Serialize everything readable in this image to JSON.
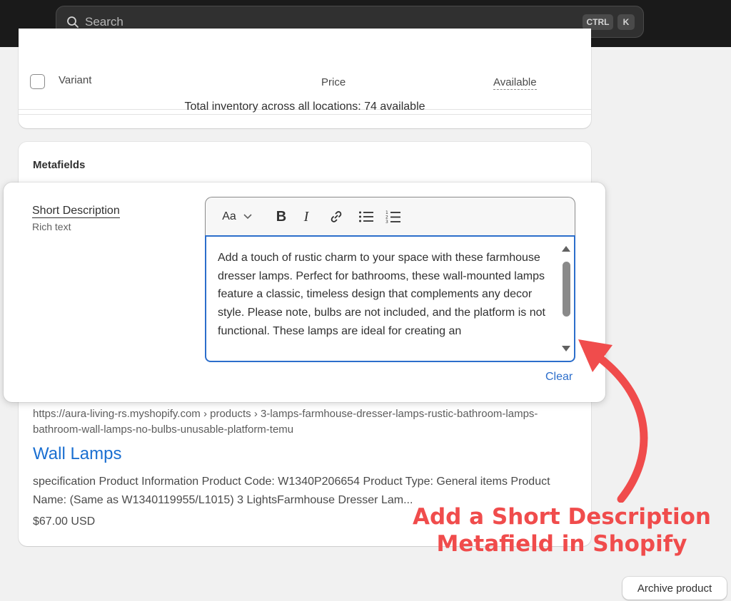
{
  "search": {
    "placeholder": "Search",
    "shortcut_ctrl": "CTRL",
    "shortcut_key": "K"
  },
  "variants": {
    "columns": {
      "variant": "Variant",
      "price": "Price",
      "available": "Available"
    },
    "total_inventory": "Total inventory across all locations: 74 available"
  },
  "metafields": {
    "title": "Metafields",
    "field": {
      "label": "Short Description",
      "type": "Rich text",
      "value": "Add a touch of rustic charm to your space with these farmhouse dresser lamps. Perfect for bathrooms, these wall-mounted lamps feature a classic, timeless design that complements any decor style. Please note, bulbs are not included, and the platform is not functional. These lamps are ideal for creating an",
      "clear_label": "Clear"
    },
    "toolbar": {
      "text_style": "Aa",
      "bold": "B",
      "italic": "I"
    }
  },
  "seo_preview": {
    "url": "https://aura-living-rs.myshopify.com › products › 3-lamps-farmhouse-dresser-lamps-rustic-bathroom-lamps-bathroom-wall-lamps-no-bulbs-unusable-platform-temu",
    "title": "Wall Lamps",
    "description": "specification Product Information Product Code: W1340P206654 Product Type: General items Product Name: (Same as W1340119955/L1015) 3 LightsFarmhouse Dresser Lam...",
    "price": "$67.00 USD"
  },
  "annotation": {
    "line1": "Add a Short Description",
    "line2": "Metafield in Shopify",
    "color": "#f04c4c"
  },
  "archive_button": "Archive product",
  "colors": {
    "link": "#2c6ecb",
    "topbar": "#1a1a1a",
    "background": "#f1f1f1"
  }
}
